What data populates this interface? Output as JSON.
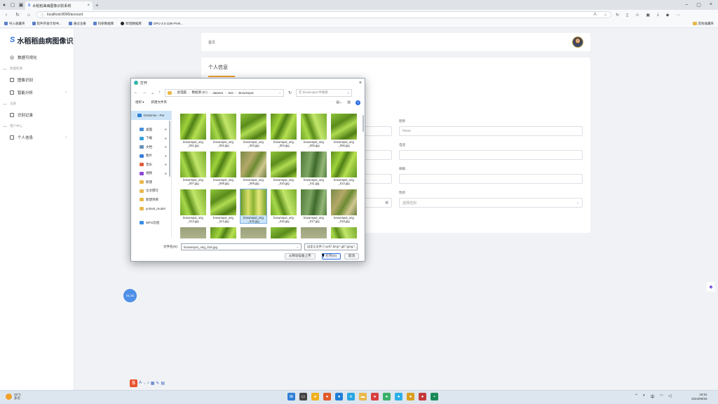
{
  "browser": {
    "tab_title": "水稻稻曲病图像识别系统",
    "url": "localhost:8000/account",
    "bookmarks": [
      "导入收藏夹",
      "软件开发计划书...",
      "通过注册",
      "科研数据库",
      "跨境数据库",
      "GPU-3.0.1(66-Prek..."
    ],
    "bookmarks_right": "其他收藏夹"
  },
  "sidebar": {
    "logo": "水稻稻曲病图像识别",
    "top_item": "数据可视化",
    "groups": [
      {
        "label": "智能检测",
        "items": [
          {
            "label": "图像识别",
            "has_chevron": false
          },
          {
            "label": "智能分析",
            "has_chevron": true
          }
        ]
      },
      {
        "label": "记录",
        "items": [
          {
            "label": "识别记录",
            "has_chevron": false
          }
        ]
      },
      {
        "label": "用户中心",
        "items": [
          {
            "label": "个人信息",
            "has_chevron": true
          }
        ]
      }
    ]
  },
  "header": {
    "breadcrumb": "首页"
  },
  "main": {
    "card_title": "个人信息",
    "fields": [
      {
        "label": "昵称",
        "value": "None"
      },
      {
        "label": "电话",
        "value": ""
      },
      {
        "label": "邮箱",
        "value": ""
      },
      {
        "label": "性别",
        "value": "选择性别"
      }
    ]
  },
  "float_btn": "01:34",
  "dialog": {
    "title": "打开",
    "path": [
      "此电脑",
      "数据源 (D:)",
      "dataset",
      "test",
      "Brownspot"
    ],
    "search_placeholder": "在 Brownspot 中搜索",
    "toolbar": {
      "organize": "组织 ▾",
      "new_folder": "新建文件夹"
    },
    "tree": [
      {
        "label": "OneDrive - Per",
        "color": "#2f7fd6"
      },
      {
        "label": "桌面",
        "color": "#4a90d9"
      },
      {
        "label": "下载",
        "color": "#3aa0e0"
      },
      {
        "label": "文档",
        "color": "#6a8fb8"
      },
      {
        "label": "图片",
        "color": "#3b7dd8"
      },
      {
        "label": "音乐",
        "color": "#e0603a"
      },
      {
        "label": "视频",
        "color": "#8a4ad8"
      },
      {
        "label": "新建",
        "color": "#e8b84a"
      },
      {
        "label": "论文撰写",
        "color": "#e8b84a"
      },
      {
        "label": "新建项目",
        "color": "#e8b84a"
      },
      {
        "label": "yolov8_model",
        "color": "#e8b84a"
      },
      {
        "label": "WPS云盘",
        "color": "#3a8ee8"
      }
    ],
    "files": [
      {
        "name1": "brownspot_orig",
        "name2": "_001.jpg",
        "tone": "a"
      },
      {
        "name1": "brownspot_orig",
        "name2": "_002.jpg",
        "tone": "b"
      },
      {
        "name1": "brownspot_orig",
        "name2": "_003.jpg",
        "tone": "c"
      },
      {
        "name1": "brownspot_orig",
        "name2": "_004.jpg",
        "tone": "a"
      },
      {
        "name1": "brownspot_orig",
        "name2": "_005.jpg",
        "tone": "b"
      },
      {
        "name1": "brownspot_orig",
        "name2": "_006.jpg",
        "tone": "c"
      },
      {
        "name1": "brownspot_orig",
        "name2": "_007.jpg",
        "tone": "b"
      },
      {
        "name1": "brownspot_orig",
        "name2": "_008.jpg",
        "tone": "a"
      },
      {
        "name1": "brownspot_orig",
        "name2": "_009.jpg",
        "tone": "d"
      },
      {
        "name1": "brownspot_orig",
        "name2": "_010.jpg",
        "tone": "c"
      },
      {
        "name1": "brownspot_orig",
        "name2": "_011.jpg",
        "tone": "e"
      },
      {
        "name1": "brownspot_orig",
        "name2": "_012.jpg",
        "tone": "a"
      },
      {
        "name1": "brownspot_orig",
        "name2": "_013.jpg",
        "tone": "b"
      },
      {
        "name1": "brownspot_orig",
        "name2": "_014.jpg",
        "tone": "c"
      },
      {
        "name1": "brownspot_orig",
        "name2": "_015.jpg",
        "tone": "f"
      },
      {
        "name1": "brownspot_orig",
        "name2": "_016.jpg",
        "tone": "b"
      },
      {
        "name1": "brownspot_orig",
        "name2": "_017.jpg",
        "tone": "e"
      },
      {
        "name1": "brownspot_orig",
        "name2": "_018.jpg",
        "tone": "d"
      },
      {
        "name1": "",
        "name2": "",
        "tone": "g"
      },
      {
        "name1": "",
        "name2": "",
        "tone": "a"
      },
      {
        "name1": "",
        "name2": "",
        "tone": "g"
      },
      {
        "name1": "",
        "name2": "",
        "tone": "c"
      },
      {
        "name1": "",
        "name2": "",
        "tone": "g"
      },
      {
        "name1": "",
        "name2": "",
        "tone": "b"
      }
    ],
    "selected_index": 14,
    "filename_label": "文件名(N):",
    "filename_value": "brownspot_orig_015.jpg",
    "filter_value": "自定义文件 (*.avif;*.bmp;*.gif;*.jpeg;*.",
    "btn_mobile": "从移动设备上传",
    "btn_open": "打开(O)",
    "btn_cancel": "取消"
  },
  "taskbar": {
    "weather_temp": "26°C",
    "weather_desc": "多云",
    "time": "18:52",
    "date": "2024/09/26"
  }
}
